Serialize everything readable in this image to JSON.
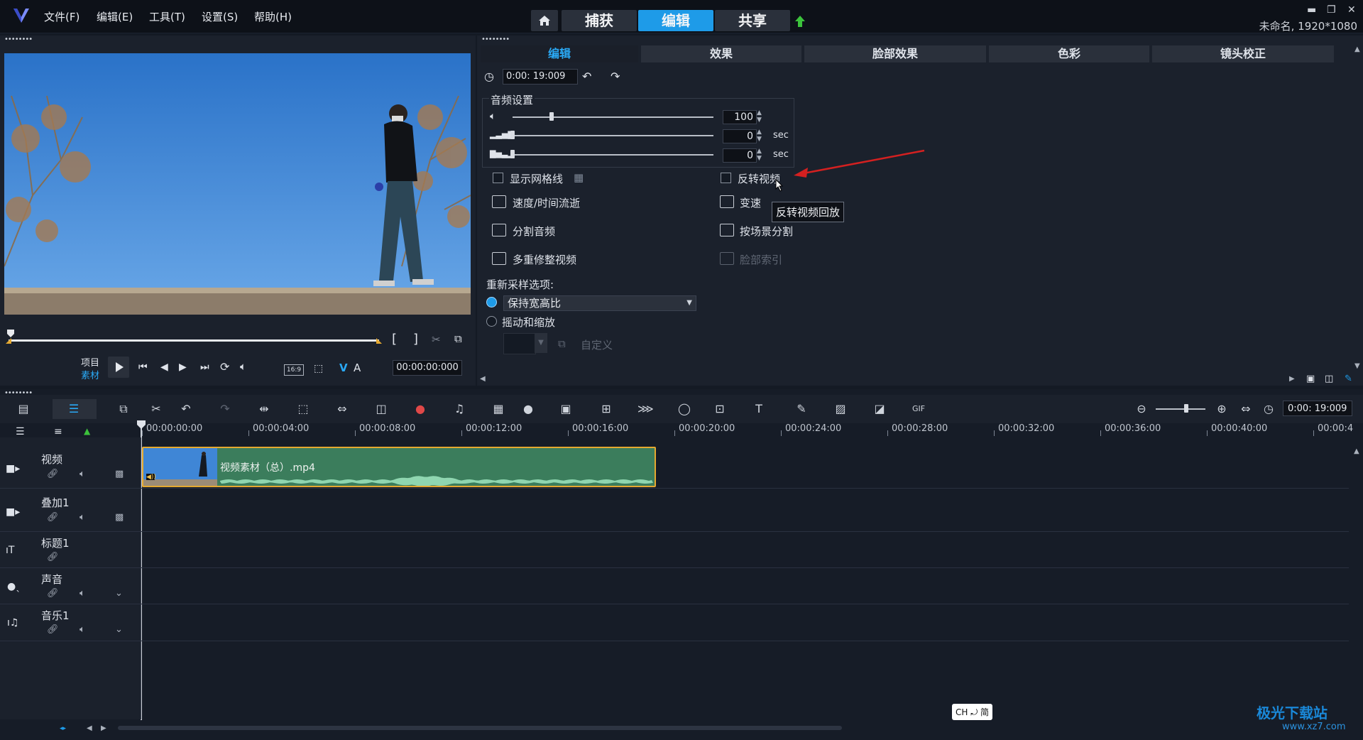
{
  "menubar": {
    "items": [
      "文件(F)",
      "编辑(E)",
      "工具(T)",
      "设置(S)",
      "帮助(H)"
    ],
    "tabs": [
      {
        "label": "捕获",
        "active": false
      },
      {
        "label": "编辑",
        "active": true
      },
      {
        "label": "共享",
        "active": false
      }
    ],
    "doc_info": "未命名, 1920*1080"
  },
  "options": {
    "tabs": [
      "编辑",
      "效果",
      "脸部效果",
      "色彩",
      "镜头校正"
    ],
    "duration": "0:00: 19:009",
    "audio_title": "音频设置",
    "volume": "100",
    "fade_in": "0",
    "fade_out": "0",
    "unit": "sec",
    "show_grid": "显示网格线",
    "reverse_video": "反转视频",
    "speed_time": "速度/时间流逝",
    "variable_speed": "变速",
    "split_audio": "分割音频",
    "split_by_scene": "按场景分割",
    "multi_trim": "多重修整视频",
    "face_index": "脸部索引",
    "resample_title": "重新采样选项:",
    "resample_value": "保持宽高比",
    "pan_zoom": "摇动和缩放",
    "custom": "自定义",
    "tooltip": "反转视频回放"
  },
  "preview": {
    "project_label": "项目",
    "clip_label": "素材",
    "aspect": "16:9",
    "timecode": "00:00:00:000"
  },
  "timeline": {
    "zoom_time": "0:00: 19:009",
    "ruler": [
      "00:00:00:00",
      "00:00:04:00",
      "00:00:08:00",
      "00:00:12:00",
      "00:00:16:00",
      "00:00:20:00",
      "00:00:24:00",
      "00:00:28:00",
      "00:00:32:00",
      "00:00:36:00",
      "00:00:40:00",
      "00:00:4"
    ],
    "tracks": [
      "视频",
      "叠加1",
      "标题1",
      "声音",
      "音乐1"
    ],
    "clip_name": "视频素材（总）.mp4"
  },
  "ime": "CH ⤾ 简",
  "watermark": {
    "name": "极光下载站",
    "url": "www.xz7.com"
  },
  "colors": {
    "accent": "#1e9be8",
    "clip": "#3b7d5c",
    "clip_border": "#e5a930",
    "arrow": "#d42020"
  }
}
